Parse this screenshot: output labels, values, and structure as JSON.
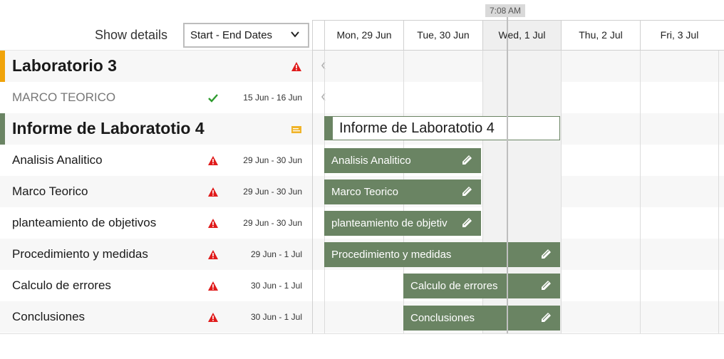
{
  "header": {
    "now_label": "7:08 AM",
    "show_details_label": "Show details",
    "details_select": {
      "value": "Start - End Dates"
    },
    "days": [
      "Mon, 29 Jun",
      "Tue, 30 Jun",
      "Wed, 1 Jul",
      "Thu, 2 Jul",
      "Fri, 3 Jul"
    ],
    "today_index": 2
  },
  "colors": {
    "bar": "#6a8463",
    "summary_orange": "#f0a30a",
    "warning": "#e01b1b",
    "ok": "#2e9b2e",
    "note": "#f0b429"
  },
  "rows": [
    {
      "kind": "summary",
      "label": "Laboratorio 3",
      "status_icon": "warning-icon",
      "dates": "",
      "bar_accent": "#f0a30a"
    },
    {
      "kind": "muted",
      "label": "MARCO TEORICO",
      "status_icon": "checkmark-icon",
      "dates": "15 Jun - 16 Jun"
    },
    {
      "kind": "summary",
      "label": "Informe de Laboratotio 4",
      "status_icon": "note-card-icon",
      "dates": "",
      "bar_accent": "#6a8463",
      "bar_label": "Informe de Laboratotio 4"
    },
    {
      "kind": "task",
      "label": "Analisis Analitico",
      "status_icon": "warning-icon",
      "dates": "29 Jun - 30 Jun",
      "bar_label": "Analisis Analitico"
    },
    {
      "kind": "task",
      "label": "Marco Teorico",
      "status_icon": "warning-icon",
      "dates": "29 Jun - 30 Jun",
      "bar_label": "Marco Teorico"
    },
    {
      "kind": "task",
      "label": "planteamiento de objetivos",
      "status_icon": "warning-icon",
      "dates": "29 Jun - 30 Jun",
      "bar_label": "planteamiento de objetiv"
    },
    {
      "kind": "task",
      "label": "Procedimiento y medidas",
      "status_icon": "warning-icon",
      "dates": "29 Jun - 1 Jul",
      "bar_label": "Procedimiento y medidas"
    },
    {
      "kind": "task",
      "label": "Calculo de errores",
      "status_icon": "warning-icon",
      "dates": "30 Jun - 1 Jul",
      "bar_label": "Calculo de errores"
    },
    {
      "kind": "task",
      "label": "Conclusiones",
      "status_icon": "warning-icon",
      "dates": "30 Jun - 1 Jul",
      "bar_label": "Conclusiones"
    }
  ]
}
